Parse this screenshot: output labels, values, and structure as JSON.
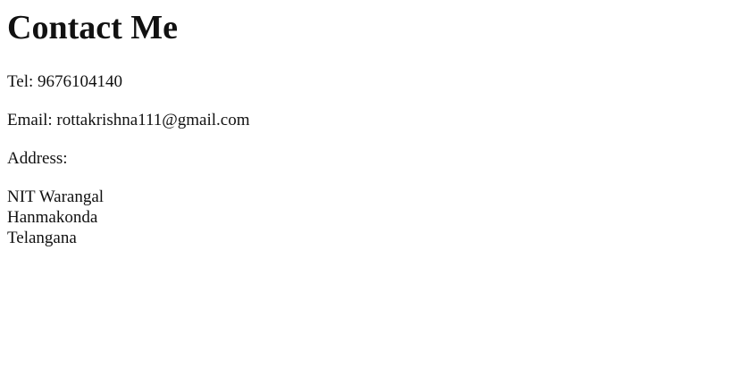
{
  "page": {
    "heading": "Contact Me",
    "tel": "Tel: 9676104140",
    "email": "Email: rottakrishna111@gmail.com",
    "address_label": "Address:",
    "address_lines": [
      "NIT Warangal",
      "Hanmakonda",
      "Telangana"
    ]
  }
}
